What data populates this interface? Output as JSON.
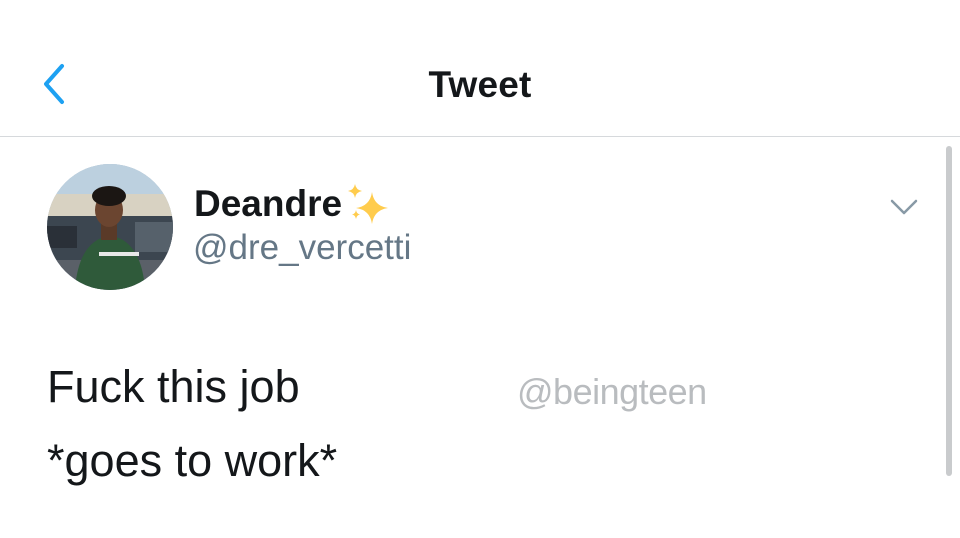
{
  "navbar": {
    "title": "Tweet",
    "back_icon": "chevron-left-icon",
    "accent_color": "#1da1f2"
  },
  "tweet": {
    "author": {
      "display_name": "Deandre",
      "emoji": "sparkles",
      "handle": "@dre_vercetti"
    },
    "text": "Fuck this job\n*goes to work*",
    "menu_icon": "chevron-down-icon"
  },
  "watermark": "@beingteen",
  "colors": {
    "text_primary": "#14171a",
    "text_secondary": "#657786",
    "divider": "#d6d9dc",
    "sparkle": "#ffcc4d"
  }
}
